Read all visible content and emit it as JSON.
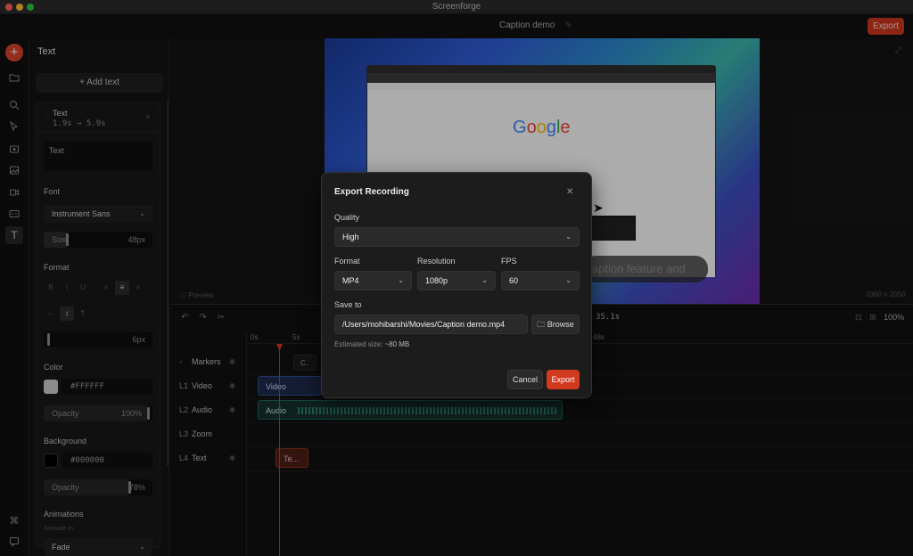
{
  "window": {
    "title": "Screenforge"
  },
  "topbar": {
    "doc_title": "Caption demo",
    "export_label": "Export"
  },
  "panel": {
    "title": "Text",
    "add_text": "+  Add text",
    "card": {
      "name": "Text",
      "range": "1.9s → 5.9s",
      "text_value": "Text",
      "font_label": "Font",
      "font_value": "Instrument Sans",
      "size_label": "Size",
      "size_value": "48px",
      "format_label": "Format",
      "spacing_value": "6px",
      "color_label": "Color",
      "color_hex": "#FFFFFF",
      "opacity_label": "Opacity",
      "opacity_value": "100%",
      "background_label": "Background",
      "background_hex": "#000000",
      "bg_opacity_label": "Opacity",
      "bg_opacity_value": "78%",
      "animations_label": "Animations",
      "animate_in_label": "Animate in",
      "animate_in_value": "Fade"
    }
  },
  "preview": {
    "label": "Preview",
    "resolution": "3360 × 2050",
    "caption_text": "aption feature and",
    "google": [
      "G",
      "o",
      "o",
      "g",
      "l",
      "e"
    ]
  },
  "timeline": {
    "time": "35.1s",
    "zoom": "100%",
    "ticks": [
      "0s",
      "5s",
      "48s"
    ],
    "tracks": [
      {
        "id": "",
        "name": "Markers"
      },
      {
        "id": "L1",
        "name": "Video"
      },
      {
        "id": "L2",
        "name": "Audio"
      },
      {
        "id": "L3",
        "name": "Zoom"
      },
      {
        "id": "L4",
        "name": "Text"
      }
    ],
    "marker_chip": "C..",
    "clips": {
      "video": "Video",
      "audio": "Audio",
      "text": "Te..."
    }
  },
  "modal": {
    "title": "Export Recording",
    "quality_label": "Quality",
    "quality_value": "High",
    "format_label": "Format",
    "format_value": "MP4",
    "resolution_label": "Resolution",
    "resolution_value": "1080p",
    "fps_label": "FPS",
    "fps_value": "60",
    "save_label": "Save to",
    "save_path": "/Users/mohibarshi/Movies/Caption demo.mp4",
    "browse_label": "Browse",
    "estimated_label": "Estimated size: ",
    "estimated_value": "~80 MB",
    "cancel_label": "Cancel",
    "export_label": "Export"
  },
  "colors": {
    "accent": "#d23a20",
    "video_clip": "#2c4b8f",
    "audio_clip": "#22655a",
    "text_clip": "#8b3020"
  }
}
